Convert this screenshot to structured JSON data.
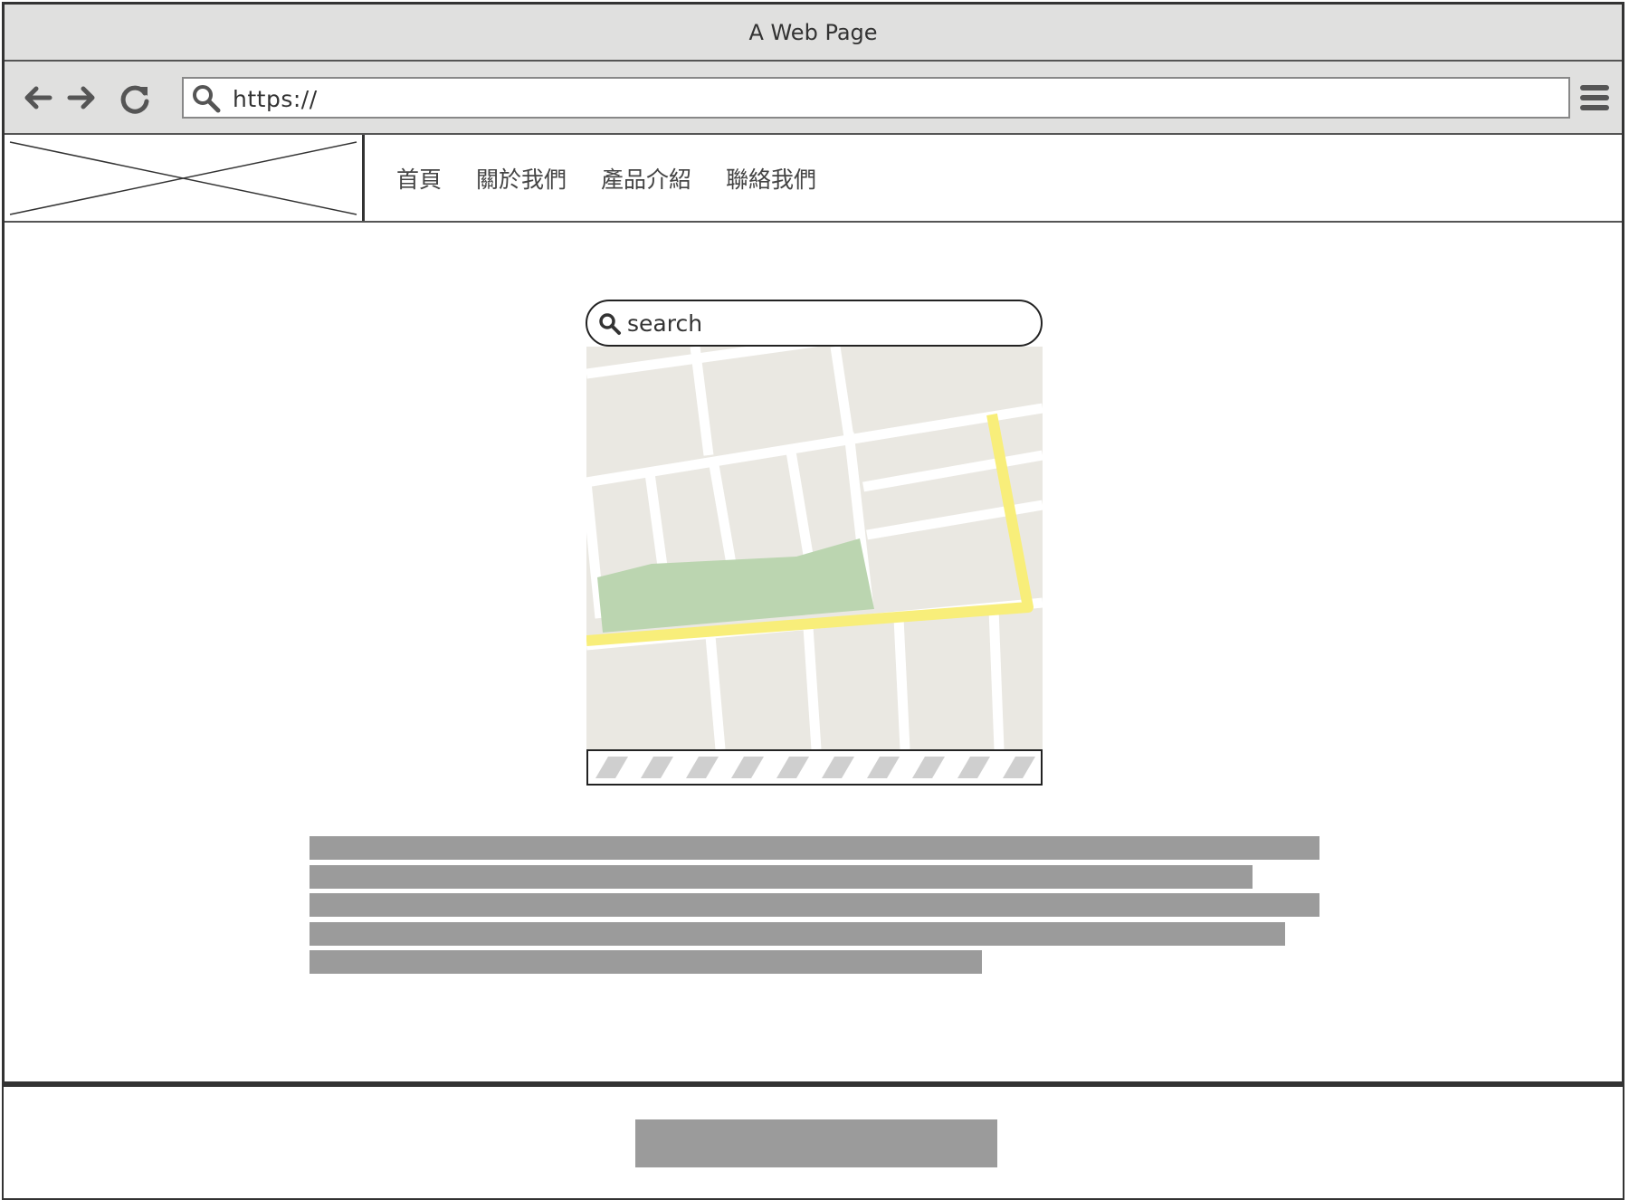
{
  "window": {
    "title": "A Web Page"
  },
  "toolbar": {
    "back_icon": "arrow-left-icon",
    "forward_icon": "arrow-right-icon",
    "reload_icon": "reload-icon",
    "url": "https://",
    "menu_icon": "hamburger-menu-icon"
  },
  "header": {
    "logo": "image-placeholder",
    "nav": [
      "首頁",
      "關於我們",
      "產品介紹",
      "聯絡我們"
    ]
  },
  "main": {
    "search": {
      "placeholder": "search",
      "icon": "search-icon"
    },
    "map": {
      "colors": {
        "background": "#eae8e2",
        "road": "#ffffff",
        "route": "#f8ee7a",
        "park": "#bbd5b0"
      }
    },
    "text_lines": 5
  },
  "colors": {
    "chrome": "#e0e0df",
    "border": "#333333",
    "placeholder_text": "#9b9b9b"
  }
}
